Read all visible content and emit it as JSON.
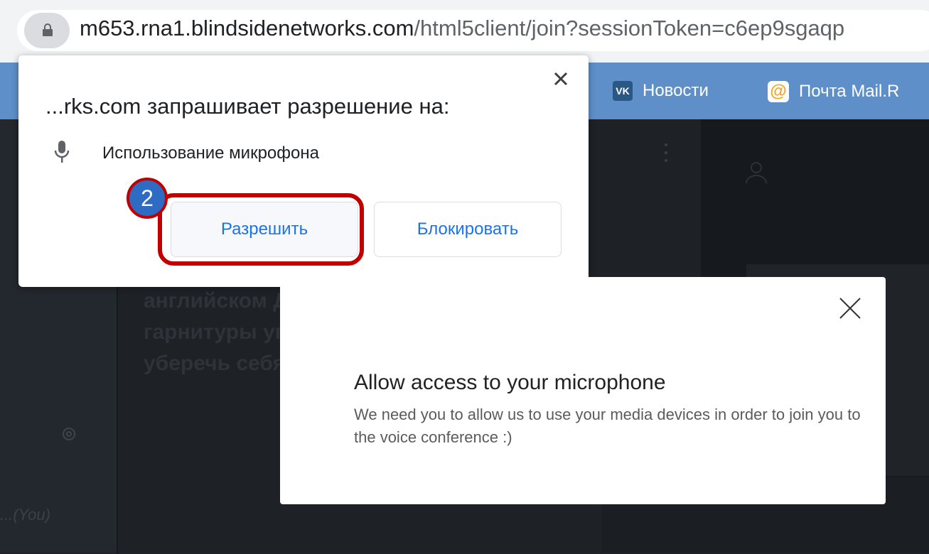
{
  "browser": {
    "url_host": "m653.rna1.blindsidenetworks.com",
    "url_rest": "/html5client/join?sessionToken=c6ep9sgaqp"
  },
  "bookmarks": [
    {
      "badge": "VK",
      "label": "Новости",
      "icon": "vk-icon"
    },
    {
      "badge": "@",
      "label": "Почта Mail.R",
      "icon": "mail-ru-icon"
    }
  ],
  "permission_prompt": {
    "title": "...rks.com запрашивает разрешение на:",
    "item": "Использование микрофона",
    "allow_label": "Разрешить",
    "block_label": "Блокировать"
  },
  "annotation": {
    "step": "2",
    "color": "#c00000"
  },
  "background_app": {
    "main_text": "английском Для участи нажмите на гарнитуры углу. Пожа гарнитуру, чтобы уберечь себя и",
    "user_label": "...(You)"
  },
  "mic_modal": {
    "title": "Allow access to your microphone",
    "description": "We need you to allow us to use your media devices in order to join you to the voice conference :)"
  },
  "colors": {
    "link_blue": "#1a73e8",
    "bookmark_bar": "#5f8fc9",
    "badge_blue": "#2e6bc2"
  }
}
